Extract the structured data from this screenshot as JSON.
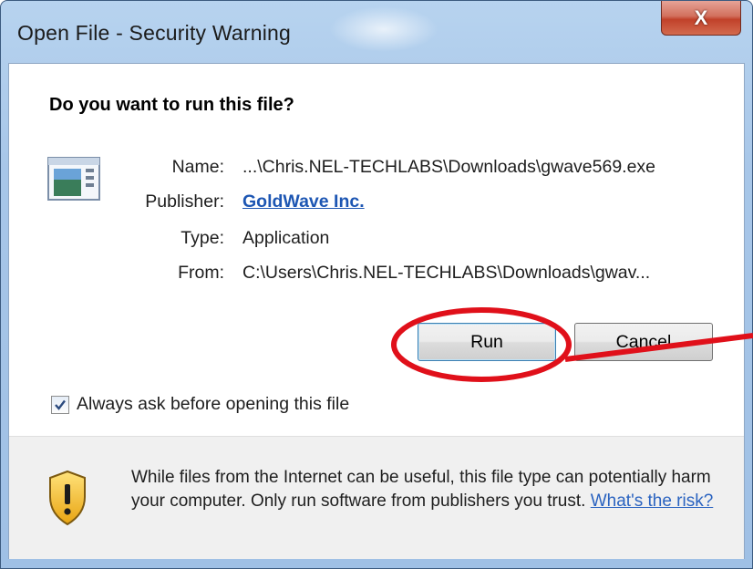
{
  "window": {
    "title": "Open File - Security Warning",
    "close_label": "X"
  },
  "dialog": {
    "question": "Do you want to run this file?",
    "fields": [
      {
        "label": "Name:",
        "value": "...\\Chris.NEL-TECHLABS\\Downloads\\gwave569.exe"
      },
      {
        "label": "Publisher:",
        "value": "GoldWave Inc."
      },
      {
        "label": "Type:",
        "value": "Application"
      },
      {
        "label": "From:",
        "value": "C:\\Users\\Chris.NEL-TECHLABS\\Downloads\\gwav..."
      }
    ],
    "run_label": "Run",
    "cancel_label": "Cancel",
    "checkbox": {
      "label": "Always ask before opening this file",
      "checked": true
    }
  },
  "footer": {
    "warning_text": "While files from the Internet can be useful, this file type can potentially harm your computer. Only run software from publishers you trust.",
    "risk_link": "What's the risk?"
  },
  "colors": {
    "annotation": "#e0101a",
    "link": "#1d56b3"
  },
  "icons": {
    "app": "application-icon",
    "shield": "warning-shield-icon",
    "check": "checkmark-icon"
  }
}
